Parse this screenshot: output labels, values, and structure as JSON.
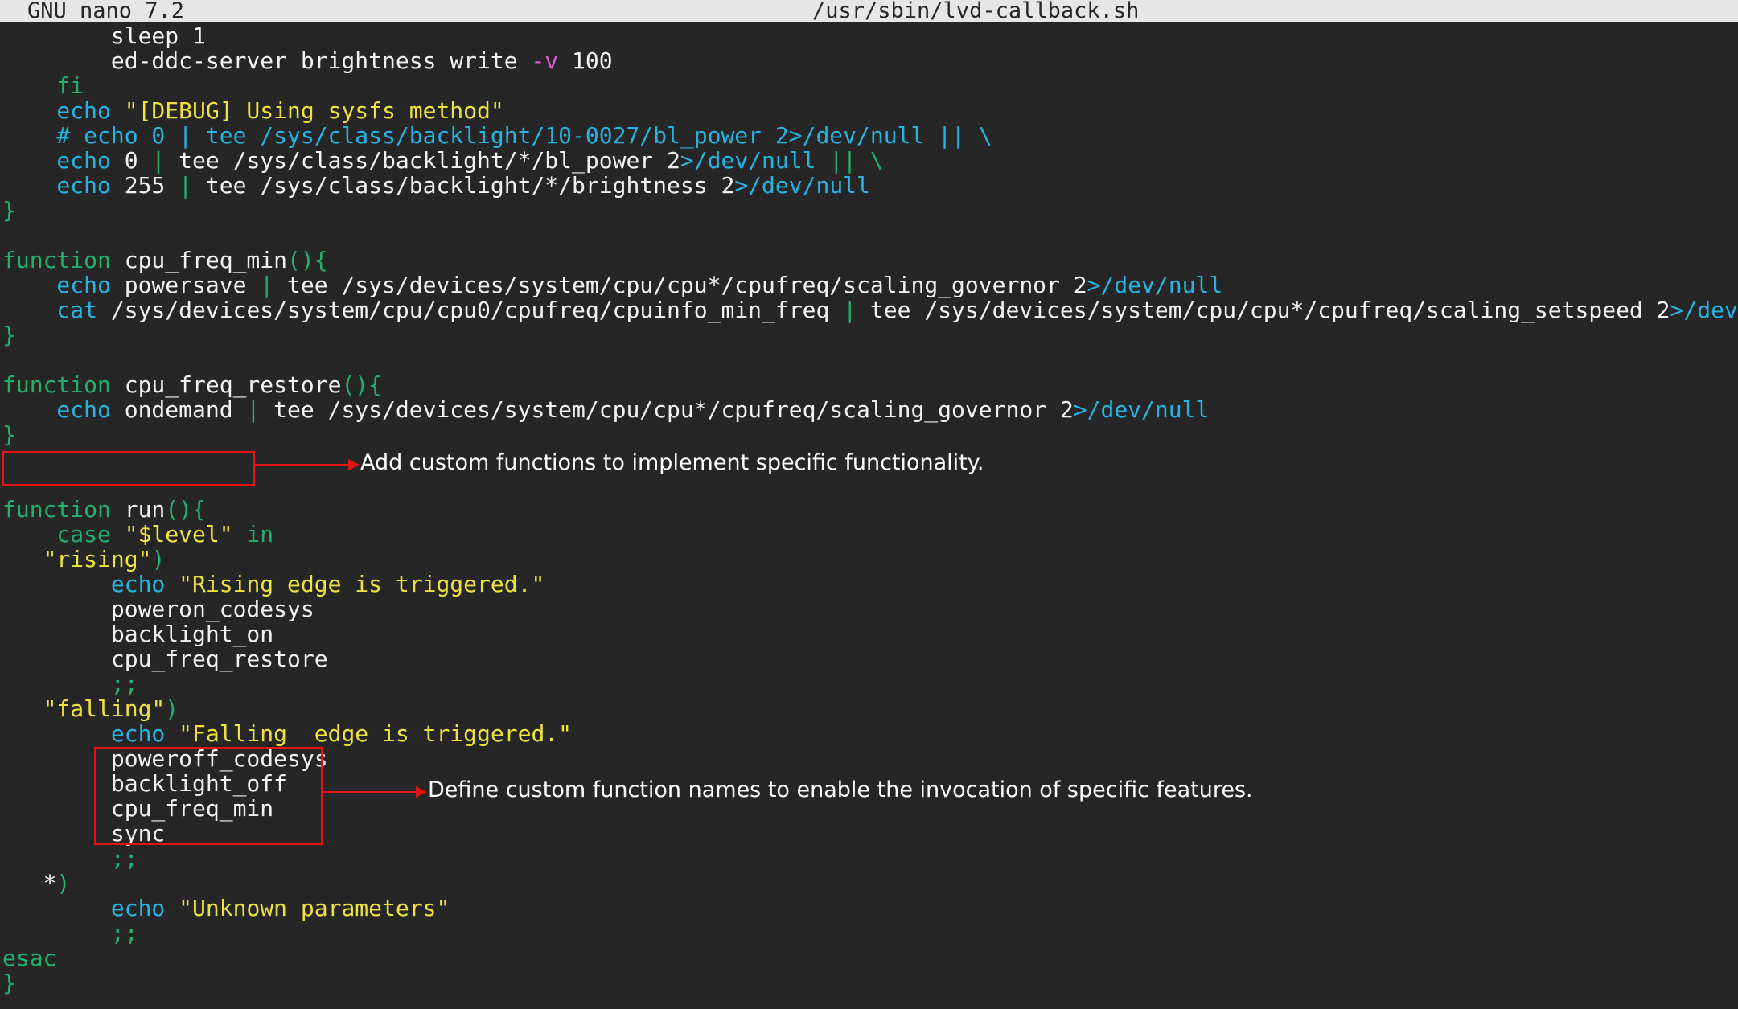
{
  "window": {
    "app_title": "GNU nano 7.2",
    "file_path": "/usr/sbin/lvd-callback.sh"
  },
  "colors": {
    "background": "#262626",
    "default_text": "#f2f2f2",
    "keyword": "#23b06f",
    "command": "#27b4e3",
    "string": "#f0e23c",
    "path": "#27b4e3",
    "option": "#e05bd1",
    "annotation_red": "#e31414"
  },
  "code_lines": [
    [
      [
        "def",
        "        sleep 1"
      ]
    ],
    [
      [
        "def",
        "        ed-ddc-server brightness write "
      ],
      [
        "opt",
        "-v"
      ],
      [
        "def",
        " 100"
      ]
    ],
    [
      [
        "kw",
        "    fi"
      ]
    ],
    [
      [
        "cmd",
        "    echo "
      ],
      [
        "str",
        "\"[DEBUG] Using sysfs method\""
      ]
    ],
    [
      [
        "com",
        "    # echo 0 | tee /sys/class/backlight/10-0027/bl_power 2>/dev/null || \\"
      ]
    ],
    [
      [
        "cmd",
        "    echo"
      ],
      [
        "def",
        " 0 "
      ],
      [
        "pun",
        "|"
      ],
      [
        "def",
        " tee /sys/class/backlight/*/bl_power 2"
      ],
      [
        "pth",
        ">/dev/null"
      ],
      [
        "pun",
        " || \\"
      ]
    ],
    [
      [
        "cmd",
        "    echo"
      ],
      [
        "def",
        " 255 "
      ],
      [
        "pun",
        "|"
      ],
      [
        "def",
        " tee /sys/class/backlight/*/brightness 2"
      ],
      [
        "pth",
        ">/dev/null"
      ]
    ],
    [
      [
        "pun",
        "}"
      ]
    ],
    [
      [
        "def",
        ""
      ]
    ],
    [
      [
        "kw",
        "function"
      ],
      [
        "def",
        " cpu_freq_min"
      ],
      [
        "pun",
        "(){"
      ]
    ],
    [
      [
        "cmd",
        "    echo"
      ],
      [
        "def",
        " powersave "
      ],
      [
        "pun",
        "|"
      ],
      [
        "def",
        " tee /sys/devices/system/cpu/cpu*/cpufreq/scaling_governor 2"
      ],
      [
        "pth",
        ">/dev/null"
      ]
    ],
    [
      [
        "cmd",
        "    cat"
      ],
      [
        "def",
        " /sys/devices/system/cpu/cpu0/cpufreq/cpuinfo_min_freq "
      ],
      [
        "pun",
        "|"
      ],
      [
        "def",
        " tee /sys/devices/system/cpu/cpu*/cpufreq/scaling_setspeed 2"
      ],
      [
        "pth",
        ">/dev/null"
      ]
    ],
    [
      [
        "pun",
        "}"
      ]
    ],
    [
      [
        "def",
        ""
      ]
    ],
    [
      [
        "kw",
        "function"
      ],
      [
        "def",
        " cpu_freq_restore"
      ],
      [
        "pun",
        "(){"
      ]
    ],
    [
      [
        "cmd",
        "    echo"
      ],
      [
        "def",
        " ondemand "
      ],
      [
        "pun",
        "|"
      ],
      [
        "def",
        " tee /sys/devices/system/cpu/cpu*/cpufreq/scaling_governor 2"
      ],
      [
        "pth",
        ">/dev/null"
      ]
    ],
    [
      [
        "pun",
        "}"
      ]
    ],
    [
      [
        "def",
        ""
      ]
    ],
    [
      [
        "def",
        ""
      ]
    ],
    [
      [
        "kw",
        "function"
      ],
      [
        "def",
        " run"
      ],
      [
        "pun",
        "(){"
      ]
    ],
    [
      [
        "kw",
        "    case "
      ],
      [
        "str",
        "\"$level\""
      ],
      [
        "kw",
        " in"
      ]
    ],
    [
      [
        "str",
        "   \"rising\""
      ],
      [
        "pun",
        ")"
      ]
    ],
    [
      [
        "cmd",
        "        echo "
      ],
      [
        "str",
        "\"Rising edge is triggered.\""
      ]
    ],
    [
      [
        "def",
        "        poweron_codesys"
      ]
    ],
    [
      [
        "def",
        "        backlight_on"
      ]
    ],
    [
      [
        "def",
        "        cpu_freq_restore"
      ]
    ],
    [
      [
        "pun",
        "        ;;"
      ]
    ],
    [
      [
        "str",
        "   \"falling\""
      ],
      [
        "pun",
        ")"
      ]
    ],
    [
      [
        "cmd",
        "        echo "
      ],
      [
        "str",
        "\"Falling  edge is triggered.\""
      ]
    ],
    [
      [
        "def",
        "        poweroff_codesys"
      ]
    ],
    [
      [
        "def",
        "        backlight_off"
      ]
    ],
    [
      [
        "def",
        "        cpu_freq_min"
      ]
    ],
    [
      [
        "def",
        "        sync"
      ]
    ],
    [
      [
        "pun",
        "        ;;"
      ]
    ],
    [
      [
        "def",
        "   *"
      ],
      [
        "pun",
        ")"
      ]
    ],
    [
      [
        "cmd",
        "        echo "
      ],
      [
        "str",
        "\"Unknown parameters\""
      ]
    ],
    [
      [
        "pun",
        "        ;;"
      ]
    ],
    [
      [
        "kw",
        "esac"
      ]
    ],
    [
      [
        "pun",
        "}"
      ]
    ]
  ],
  "annotations": {
    "custom_functions": "Add custom functions to implement specific functionality.",
    "function_invocation": "Define custom function names to enable the invocation of specific features."
  }
}
